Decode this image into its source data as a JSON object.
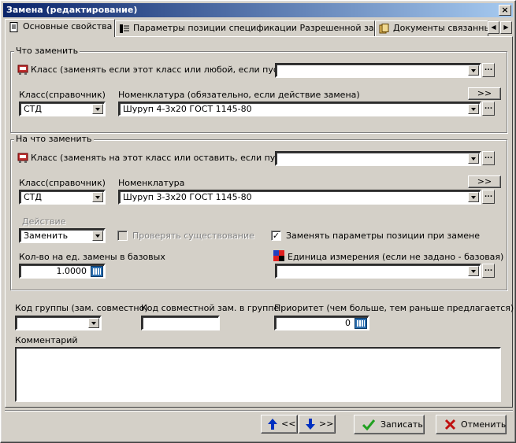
{
  "window": {
    "title": "Замена (редактирование)",
    "close": "×"
  },
  "tabs": [
    {
      "label": "Основные свойства"
    },
    {
      "label": "Параметры позиции спецификации Разрешенной замены"
    },
    {
      "label": "Документы связанные"
    }
  ],
  "tab_scroll": {
    "left": "◀",
    "right": "▶"
  },
  "what": {
    "title": "Что заменить",
    "class_label": "Класс (заменять если этот класс или любой, если пустое):",
    "class_value": "",
    "ref_class_label": "Класс(справочник)",
    "ref_class_value": "СТД",
    "nomen_label": "Номенклатура (обязательно, если действие замена)",
    "nomen_value": "Шуруп 4-3x20 ГОСТ 1145-80",
    "expand": ">>"
  },
  "to": {
    "title": "На что заменить",
    "class_label": "Класс (заменять на этот класс или оставить, если пустое):",
    "class_value": "",
    "ref_class_label": "Класс(справочник)",
    "ref_class_value": "СТД",
    "nomen_label": "Номенклатура",
    "nomen_value": "Шуруп 3-3x20 ГОСТ 1145-80",
    "expand": ">>",
    "action_label": "Действие",
    "action_value": "Заменить",
    "check_existence_label": "Проверять существование",
    "replace_params_label": "Заменять параметры позиции при замене",
    "replace_params_checked": true,
    "qty_label": "Кол-во на ед. замены в базовых",
    "qty_value": "1.0000",
    "unit_label": "Единица измерения (если не задано - базовая)",
    "unit_value": ""
  },
  "extra": {
    "group_code_label": "Код группы (зам. совместно)",
    "group_code_value": "",
    "joint_code_label": "Код совместной зам. в группе",
    "joint_code_value": "",
    "priority_label": "Приоритет (чем больше, тем раньше предлагается)",
    "priority_value": "0",
    "comment_label": "Комментарий",
    "comment_value": ""
  },
  "footer": {
    "prev_label": "<<",
    "next_label": ">>",
    "save_label": "Записать",
    "cancel_label": "Отменить"
  },
  "ellipsis": "..."
}
